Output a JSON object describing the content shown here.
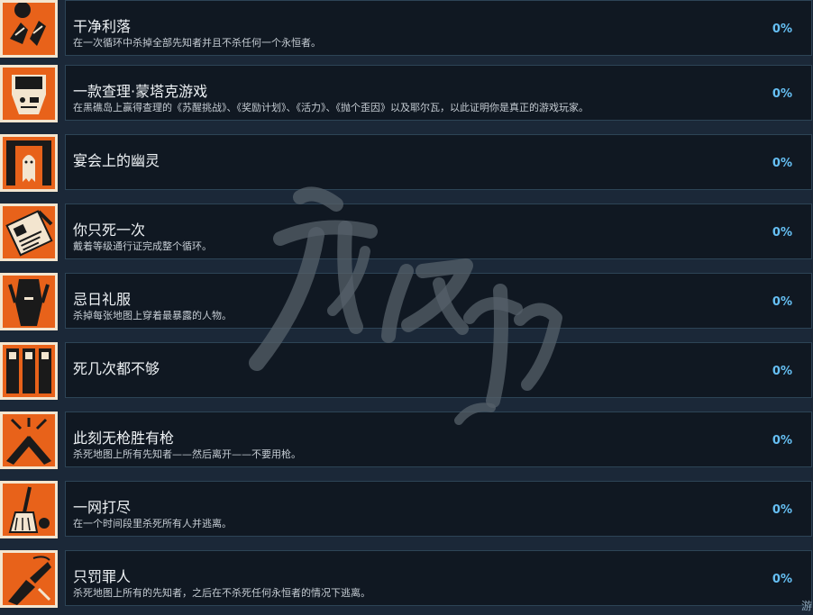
{
  "achievements": [
    {
      "title": "干净利落",
      "desc": "在一次循环中杀掉全部先知者并且不杀任何一个永恒者。",
      "percent": "0%",
      "icon": "hands-icon"
    },
    {
      "title": "一款查理·蒙塔克游戏",
      "desc": "在黑礁岛上赢得查理的《苏醒挑战》、《奖励计划》、《活力》、《抛个歪因》以及耶尔瓦，以此证明你是真正的游戏玩家。",
      "percent": "0%",
      "icon": "arcade-icon"
    },
    {
      "title": "宴会上的幽灵",
      "desc": "",
      "percent": "0%",
      "icon": "ghost-icon"
    },
    {
      "title": "你只死一次",
      "desc": "戴着等级通行证完成整个循环。",
      "percent": "0%",
      "icon": "pass-card-icon"
    },
    {
      "title": "忌日礼服",
      "desc": "杀掉每张地图上穿着最暴露的人物。",
      "percent": "0%",
      "icon": "outfit-icon"
    },
    {
      "title": "死几次都不够",
      "desc": "",
      "percent": "0%",
      "icon": "coffins-icon"
    },
    {
      "title": "此刻无枪胜有枪",
      "desc": "杀死地图上所有先知者——然后离开——不要用枪。",
      "percent": "0%",
      "icon": "crossed-hands-icon"
    },
    {
      "title": "一网打尽",
      "desc": "在一个时间段里杀死所有人并逃离。",
      "percent": "0%",
      "icon": "broom-icon"
    },
    {
      "title": "只罚罪人",
      "desc": "杀死地图上所有的先知者，之后在不杀死任何永恒者的情况下逃离。",
      "percent": "0%",
      "icon": "punish-icon"
    }
  ],
  "corner_text": "游"
}
